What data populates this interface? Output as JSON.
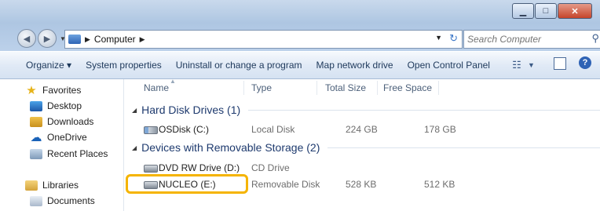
{
  "window": {
    "caption_buttons": [
      "minimize-icon",
      "maximize-icon",
      "close-icon"
    ],
    "accent": "#f5b400"
  },
  "address": {
    "path": "Computer"
  },
  "search": {
    "placeholder": "Search Computer"
  },
  "toolbar": {
    "organize": "Organize",
    "system_properties": "System properties",
    "uninstall": "Uninstall or change a program",
    "map_drive": "Map network drive",
    "control_panel": "Open Control Panel"
  },
  "sidebar": {
    "favorites": "Favorites",
    "desktop": "Desktop",
    "downloads": "Downloads",
    "onedrive": "OneDrive",
    "recent": "Recent Places",
    "libraries": "Libraries",
    "documents": "Documents"
  },
  "columns": {
    "name": "Name",
    "type": "Type",
    "total": "Total Size",
    "free": "Free Space"
  },
  "groups": {
    "hdd": {
      "label": "Hard Disk Drives (1)",
      "items": [
        {
          "name": "OSDisk (C:)",
          "type": "Local Disk",
          "total": "224 GB",
          "free": "178 GB"
        }
      ]
    },
    "removable": {
      "label": "Devices with Removable Storage (2)",
      "items": [
        {
          "name": "DVD RW Drive (D:)",
          "type": "CD Drive",
          "total": "",
          "free": ""
        },
        {
          "name": "NUCLEO (E:)",
          "type": "Removable Disk",
          "total": "528 KB",
          "free": "512 KB"
        }
      ]
    }
  }
}
